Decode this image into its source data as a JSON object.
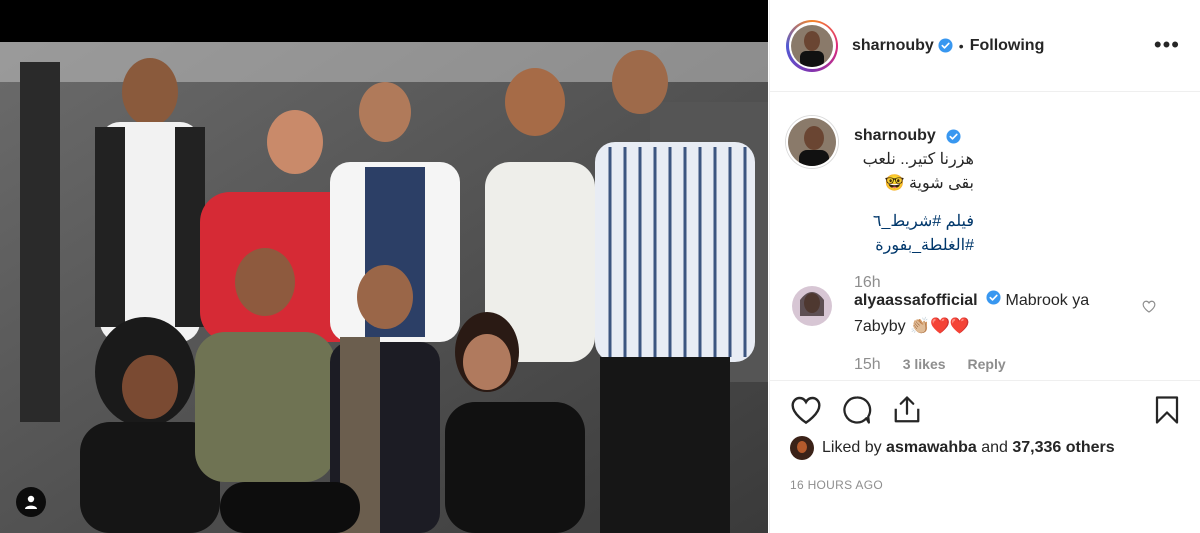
{
  "header": {
    "username": "sharnouby",
    "separator": "•",
    "follow_label": "Following",
    "more_label": "•••"
  },
  "caption": {
    "username": "sharnouby",
    "text": "هزرنا كتير.. نلعب بقى شوية 🤓",
    "line2": "فيلم #شريط_٦",
    "hashtag2": "#الغلطة_بفورة",
    "time": "16h"
  },
  "comment": {
    "username": "alyaassafofficial",
    "text": "Mabrook ya 7abyby 👏🏼❤️❤️",
    "time": "15h",
    "likes": "3 likes",
    "reply": "Reply"
  },
  "likes": {
    "prefix": "Liked by",
    "user": "asmawahba",
    "middle": "and",
    "count": "37,336 others"
  },
  "timestamp": "16 HOURS AGO",
  "colors": {
    "text": "#262626",
    "muted": "#8e8e8e",
    "verified": "#3897f0",
    "hashtag": "#00376b",
    "heart": "#ed4956"
  },
  "icons": [
    "heart-icon",
    "comment-icon",
    "share-icon",
    "bookmark-icon",
    "verified-icon",
    "more-icon",
    "tag-people-icon"
  ]
}
